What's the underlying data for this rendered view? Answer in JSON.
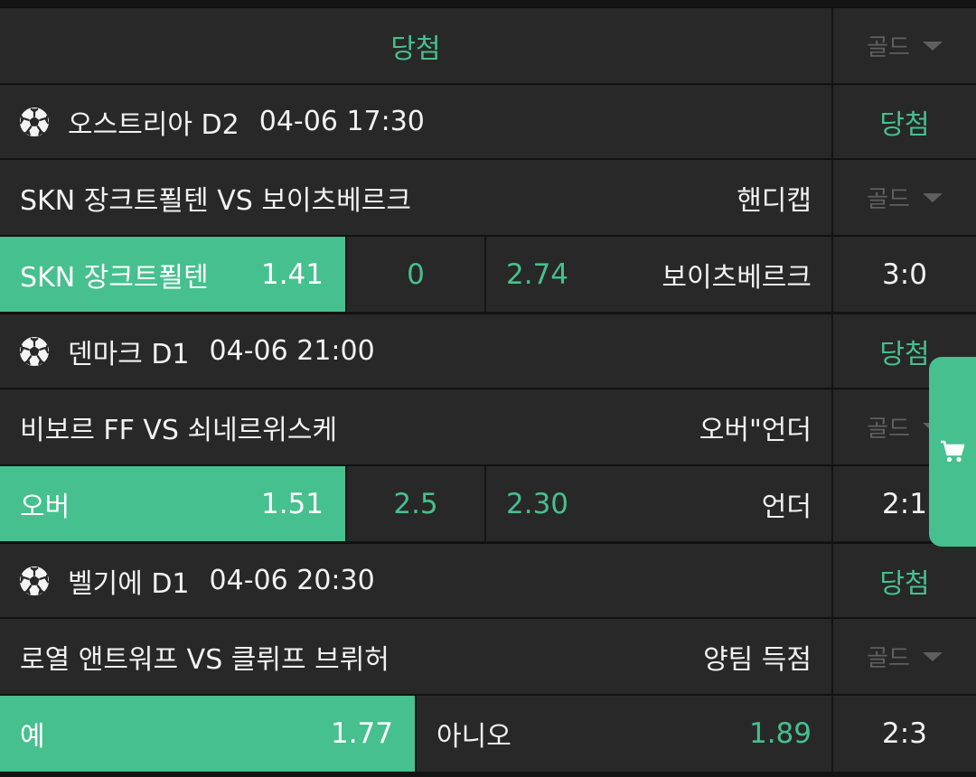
{
  "top": {
    "status": "당첨",
    "gold": "골드"
  },
  "matches": [
    {
      "league": "오스트리아 D2",
      "datetime": "04-06 17:30",
      "status": "당첨",
      "teams": "SKN 장크트푈텐 VS 보이츠베르크",
      "market": "핸디캡",
      "gold": "골드",
      "pick_left_label": "SKN 장크트푈텐",
      "pick_left_odds": "1.41",
      "middle": "0",
      "right_odds": "2.74",
      "right_label": "보이츠베르크",
      "score": "3:0"
    },
    {
      "league": "덴마크 D1",
      "datetime": "04-06 21:00",
      "status": "당첨",
      "teams": "비보르 FF VS 쇠네르위스케",
      "market": "오버\"언더",
      "gold": "골드",
      "pick_left_label": "오버",
      "pick_left_odds": "1.51",
      "middle": "2.5",
      "right_odds": "2.30",
      "right_label": "언더",
      "score": "2:1"
    },
    {
      "league": "벨기에 D1",
      "datetime": "04-06 20:30",
      "status": "당첨",
      "teams": "로열 앤트워프 VS 클뤼프 브뤼허",
      "market": "양팀 득점",
      "gold": "골드",
      "pick_left_label": "예",
      "pick_left_odds": "1.77",
      "right_label": "아니오",
      "right_odds": "1.89",
      "score": "2:3"
    }
  ],
  "icons": {
    "ball": "soccer-ball-icon",
    "cart": "cart-icon"
  },
  "colors": {
    "accent": "#46c08e",
    "row_bg": "#282828",
    "divider": "#141414"
  }
}
